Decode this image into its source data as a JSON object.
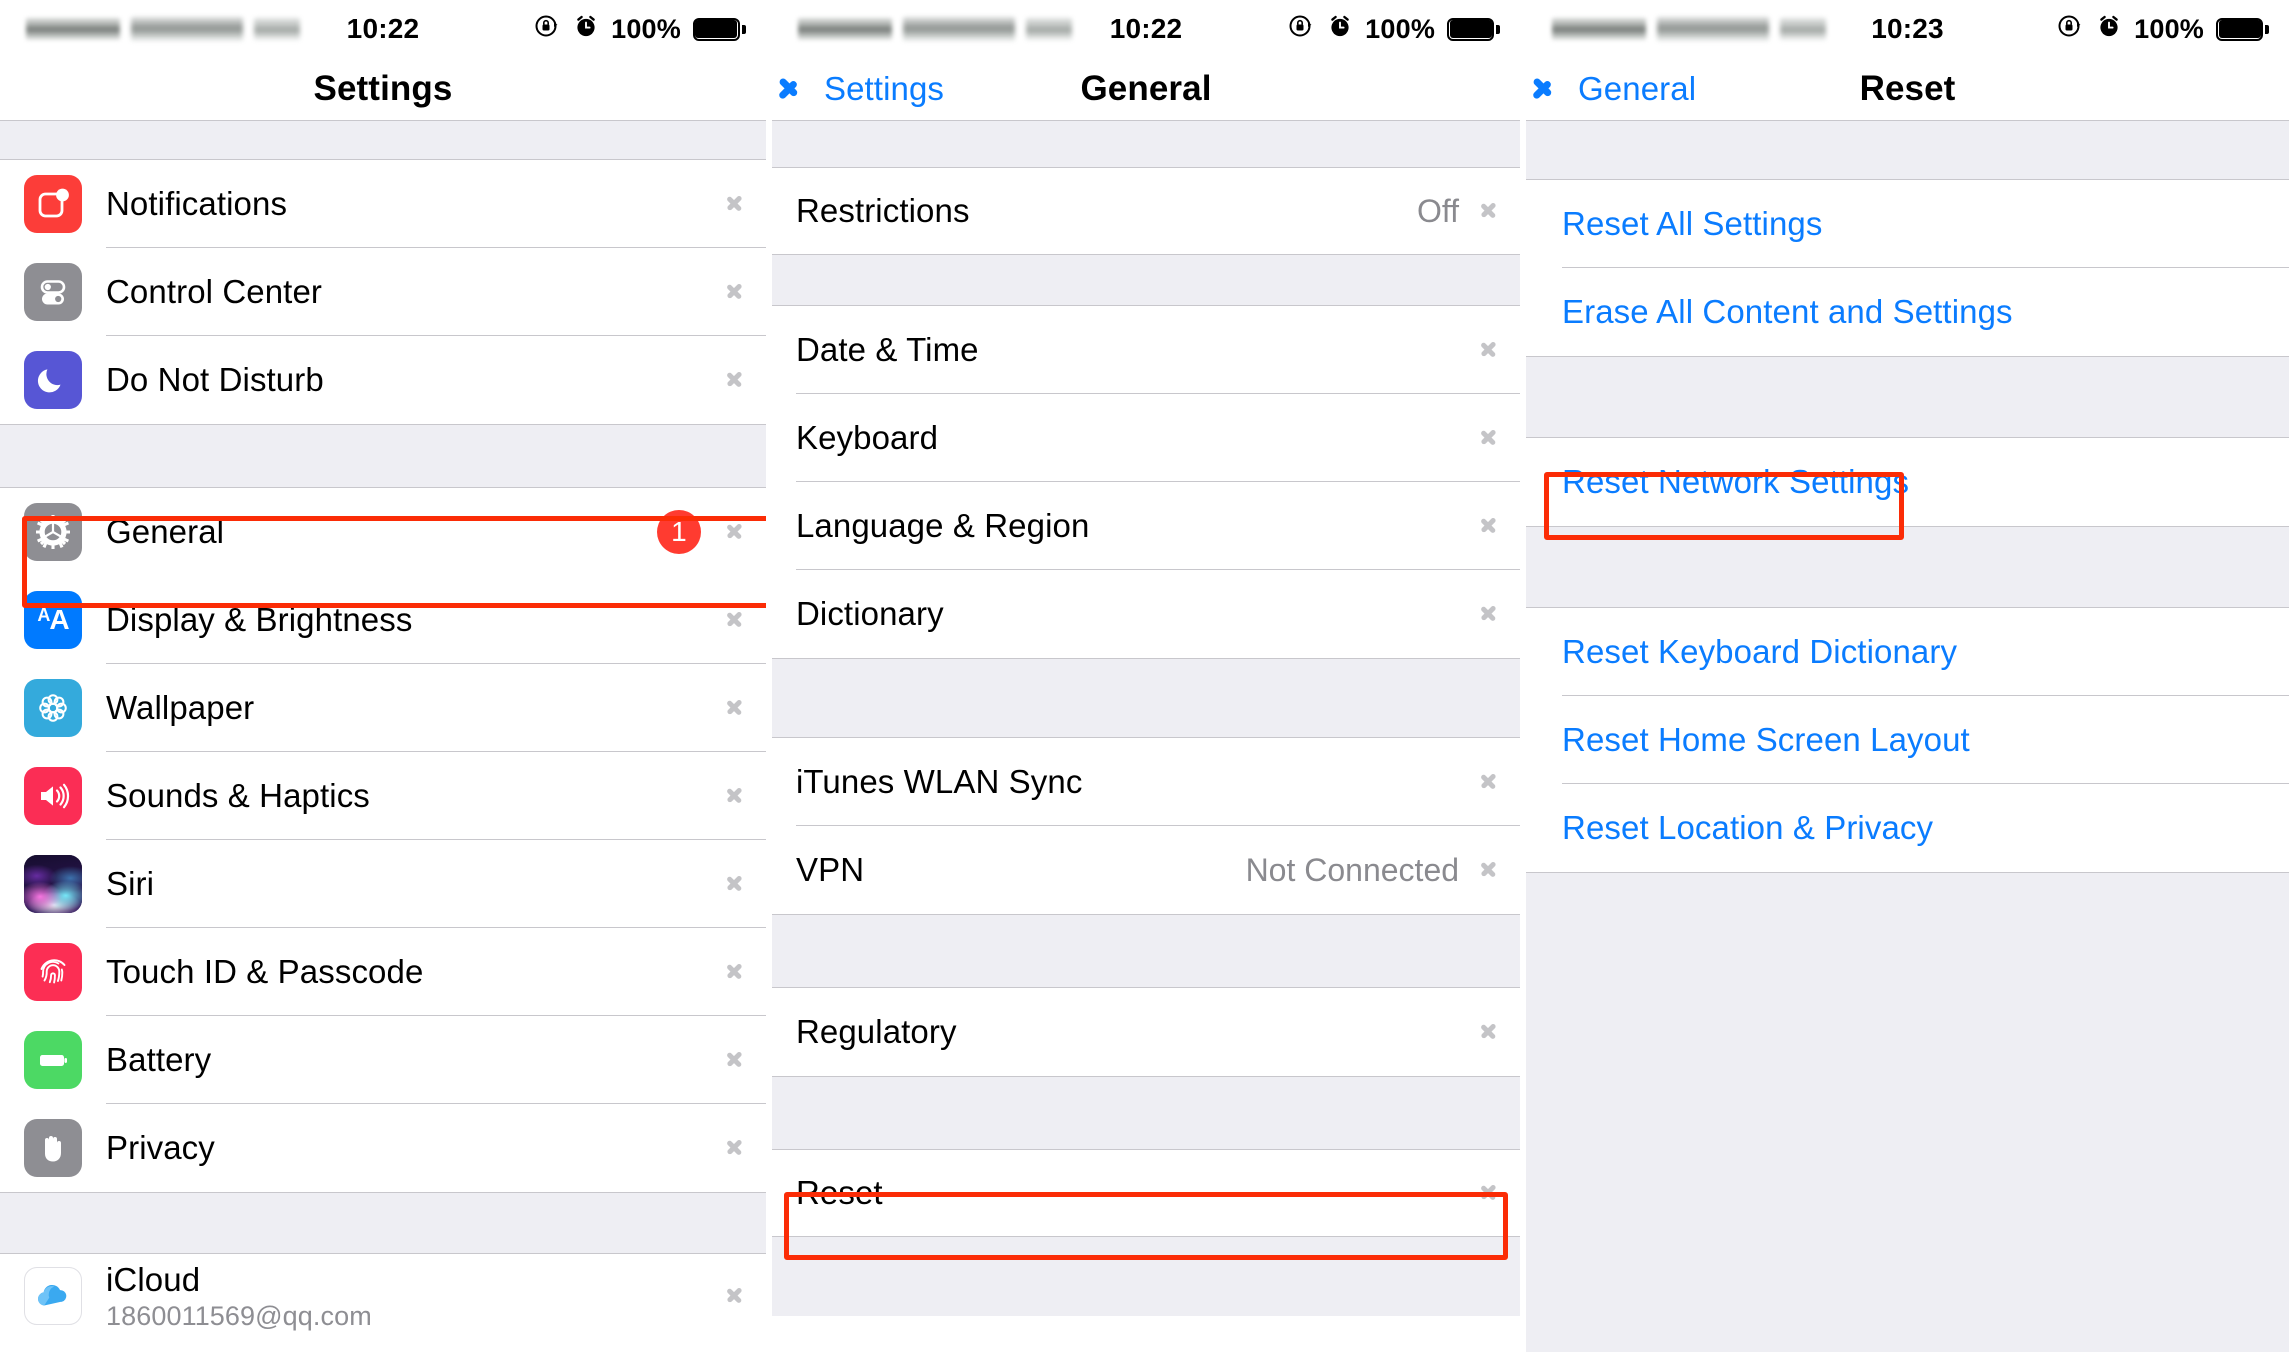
{
  "panels": [
    {
      "id": "settings",
      "status_bar": {
        "time": "10:22",
        "battery_percent": "100%",
        "rotation_lock_icon": "rotation-lock-icon",
        "alarm_icon": "alarm-clock-icon",
        "battery_icon": "battery-full-icon",
        "carrier_redacted": true
      },
      "nav": {
        "title": "Settings",
        "back_label": null
      },
      "groups": [
        {
          "rows": [
            {
              "label": "Notifications",
              "icon": "notifications-icon",
              "value": null,
              "badge": null,
              "chevron": true
            },
            {
              "label": "Control Center",
              "icon": "control-center-icon",
              "value": null,
              "badge": null,
              "chevron": true
            },
            {
              "label": "Do Not Disturb",
              "icon": "do-not-disturb-icon",
              "value": null,
              "badge": null,
              "chevron": true
            }
          ]
        },
        {
          "rows": [
            {
              "label": "General",
              "icon": "general-gear-icon",
              "value": null,
              "badge": "1",
              "chevron": true,
              "highlighted": true
            },
            {
              "label": "Display & Brightness",
              "icon": "display-brightness-icon",
              "value": null,
              "badge": null,
              "chevron": true
            },
            {
              "label": "Wallpaper",
              "icon": "wallpaper-icon",
              "value": null,
              "badge": null,
              "chevron": true
            },
            {
              "label": "Sounds & Haptics",
              "icon": "sounds-haptics-icon",
              "value": null,
              "badge": null,
              "chevron": true
            },
            {
              "label": "Siri",
              "icon": "siri-icon",
              "value": null,
              "badge": null,
              "chevron": true
            },
            {
              "label": "Touch ID & Passcode",
              "icon": "touch-id-icon",
              "value": null,
              "badge": null,
              "chevron": true
            },
            {
              "label": "Battery",
              "icon": "battery-icon",
              "value": null,
              "badge": null,
              "chevron": true
            },
            {
              "label": "Privacy",
              "icon": "privacy-hand-icon",
              "value": null,
              "badge": null,
              "chevron": true
            }
          ]
        },
        {
          "rows": [
            {
              "label": "iCloud",
              "sublabel": "1860011569@qq.com",
              "icon": "icloud-icon",
              "value": null,
              "badge": null,
              "chevron": true
            }
          ]
        }
      ]
    },
    {
      "id": "general",
      "status_bar": {
        "time": "10:22",
        "battery_percent": "100%",
        "rotation_lock_icon": "rotation-lock-icon",
        "alarm_icon": "alarm-clock-icon",
        "battery_icon": "battery-full-icon",
        "carrier_redacted": true
      },
      "nav": {
        "title": "General",
        "back_label": "Settings"
      },
      "groups": [
        {
          "rows": [
            {
              "label": "Restrictions",
              "value": "Off",
              "chevron": true
            }
          ]
        },
        {
          "rows": [
            {
              "label": "Date & Time",
              "value": null,
              "chevron": true
            },
            {
              "label": "Keyboard",
              "value": null,
              "chevron": true
            },
            {
              "label": "Language & Region",
              "value": null,
              "chevron": true
            },
            {
              "label": "Dictionary",
              "value": null,
              "chevron": true
            }
          ]
        },
        {
          "rows": [
            {
              "label": "iTunes WLAN Sync",
              "value": null,
              "chevron": true
            },
            {
              "label": "VPN",
              "value": "Not Connected",
              "chevron": true
            }
          ]
        },
        {
          "rows": [
            {
              "label": "Regulatory",
              "value": null,
              "chevron": true
            }
          ]
        },
        {
          "rows": [
            {
              "label": "Reset",
              "value": null,
              "chevron": true,
              "highlighted": true
            }
          ]
        }
      ]
    },
    {
      "id": "reset",
      "status_bar": {
        "time": "10:23",
        "battery_percent": "100%",
        "rotation_lock_icon": "rotation-lock-icon",
        "alarm_icon": "alarm-clock-icon",
        "battery_icon": "battery-full-icon",
        "carrier_redacted": true
      },
      "nav": {
        "title": "Reset",
        "back_label": "General"
      },
      "groups": [
        {
          "rows": [
            {
              "label": "Reset All Settings",
              "link": true
            },
            {
              "label": "Erase All Content and Settings",
              "link": true
            }
          ]
        },
        {
          "rows": [
            {
              "label": "Reset Network Settings",
              "link": true,
              "highlighted": true
            }
          ]
        },
        {
          "rows": [
            {
              "label": "Reset Keyboard Dictionary",
              "link": true
            },
            {
              "label": "Reset Home Screen Layout",
              "link": true
            },
            {
              "label": "Reset Location & Privacy",
              "link": true
            }
          ]
        }
      ]
    }
  ],
  "colors": {
    "accent_blue": "#0a7cff",
    "highlight_red": "#fb2c06",
    "badge_red": "#ff3b30",
    "group_gap": "#eeeef3",
    "separator": "#c8c7cc",
    "secondary_text": "#8a8a8f"
  }
}
